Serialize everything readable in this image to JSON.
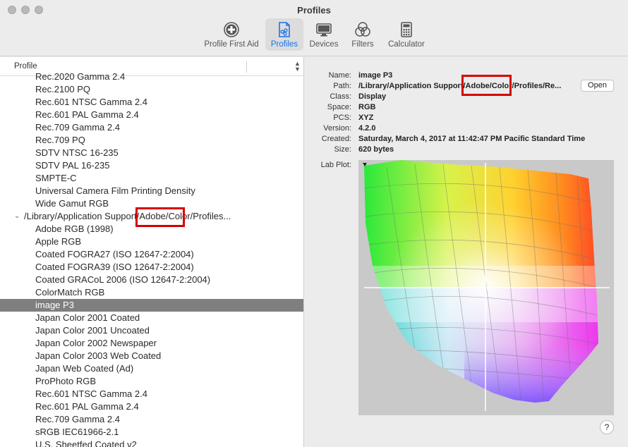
{
  "window": {
    "title": "Profiles"
  },
  "toolbar": [
    {
      "label": "Profile First Aid",
      "icon": "plus-circle-icon"
    },
    {
      "label": "Profiles",
      "icon": "document-icon",
      "active": true
    },
    {
      "label": "Devices",
      "icon": "monitor-icon"
    },
    {
      "label": "Filters",
      "icon": "venn-circles-icon"
    },
    {
      "label": "Calculator",
      "icon": "calculator-icon"
    }
  ],
  "list_header": {
    "label": "Profile"
  },
  "profiles": [
    {
      "label": "Rec.2020 Gamma 2.4"
    },
    {
      "label": "Rec.2100 PQ"
    },
    {
      "label": "Rec.601 NTSC Gamma 2.4"
    },
    {
      "label": "Rec.601 PAL Gamma 2.4"
    },
    {
      "label": "Rec.709 Gamma 2.4"
    },
    {
      "label": "Rec.709 PQ"
    },
    {
      "label": "SDTV NTSC 16-235"
    },
    {
      "label": "SDTV PAL 16-235"
    },
    {
      "label": "SMPTE-C"
    },
    {
      "label": "Universal Camera Film Printing Density"
    },
    {
      "label": "Wide Gamut RGB"
    },
    {
      "label": "/Library/Application Support/Adobe/Color/Profiles...",
      "group": true
    },
    {
      "label": "Adobe RGB (1998)"
    },
    {
      "label": "Apple RGB"
    },
    {
      "label": "Coated FOGRA27 (ISO 12647-2:2004)"
    },
    {
      "label": "Coated FOGRA39 (ISO 12647-2:2004)"
    },
    {
      "label": "Coated GRACoL 2006 (ISO 12647-2:2004)"
    },
    {
      "label": "ColorMatch RGB"
    },
    {
      "label": "image P3",
      "selected": true
    },
    {
      "label": "Japan Color 2001 Coated"
    },
    {
      "label": "Japan Color 2001 Uncoated"
    },
    {
      "label": "Japan Color 2002 Newspaper"
    },
    {
      "label": "Japan Color 2003 Web Coated"
    },
    {
      "label": "Japan Web Coated (Ad)"
    },
    {
      "label": "ProPhoto RGB"
    },
    {
      "label": "Rec.601 NTSC Gamma 2.4"
    },
    {
      "label": "Rec.601 PAL Gamma 2.4"
    },
    {
      "label": "Rec.709 Gamma 2.4"
    },
    {
      "label": "sRGB IEC61966-2.1"
    },
    {
      "label": "U.S. Sheetfed Coated v2"
    }
  ],
  "details": {
    "name_label": "Name:",
    "name": "image P3",
    "path_label": "Path:",
    "path": "/Library/Application Support/Adobe/Color/Profiles/Re...",
    "class_label": "Class:",
    "class": "Display",
    "space_label": "Space:",
    "space": "RGB",
    "pcs_label": "PCS:",
    "pcs": "XYZ",
    "version_label": "Version:",
    "version": "4.2.0",
    "created_label": "Created:",
    "created": "Saturday, March 4, 2017 at 11:42:47 PM Pacific Standard Time",
    "size_label": "Size:",
    "size": "620 bytes",
    "open_label": "Open",
    "plot_label": "Lab Plot:"
  },
  "help": {
    "label": "?"
  },
  "colors": {
    "selection": "#7f7f7f",
    "accent": "#1a73e8",
    "annotation": "#d60000"
  }
}
